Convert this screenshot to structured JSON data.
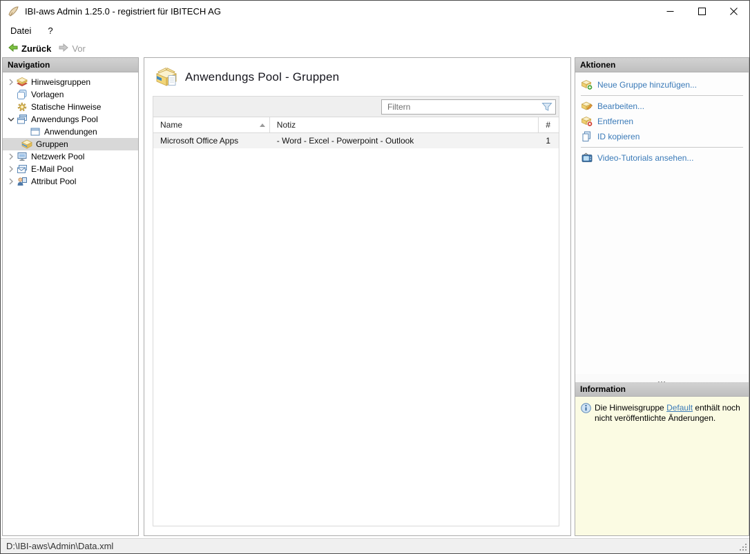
{
  "window": {
    "title": "IBI-aws Admin 1.25.0 - registriert für IBITECH AG",
    "controls": {
      "minimize": "minimize",
      "maximize": "maximize",
      "close": "close"
    }
  },
  "menu": {
    "items": [
      {
        "label": "Datei"
      },
      {
        "label": "?"
      }
    ]
  },
  "toolbar": {
    "back_label": "Zurück",
    "forward_label": "Vor"
  },
  "navigation": {
    "header": "Navigation",
    "items": [
      {
        "label": "Hinweisgruppen",
        "icon": "notice-groups-icon",
        "state": "collapsed",
        "level": 0,
        "selected": false
      },
      {
        "label": "Vorlagen",
        "icon": "templates-icon",
        "state": "leaf",
        "level": 0,
        "selected": false
      },
      {
        "label": "Statische Hinweise",
        "icon": "static-notices-icon",
        "state": "leaf",
        "level": 0,
        "selected": false
      },
      {
        "label": "Anwendungs Pool",
        "icon": "application-pool-icon",
        "state": "expanded",
        "level": 0,
        "selected": false
      },
      {
        "label": "Anwendungen",
        "icon": "applications-icon",
        "state": "leaf",
        "level": 1,
        "selected": false
      },
      {
        "label": "Gruppen",
        "icon": "groups-icon",
        "state": "leaf",
        "level": 1,
        "selected": true
      },
      {
        "label": "Netzwerk Pool",
        "icon": "network-pool-icon",
        "state": "collapsed",
        "level": 0,
        "selected": false
      },
      {
        "label": "E-Mail Pool",
        "icon": "email-pool-icon",
        "state": "collapsed",
        "level": 0,
        "selected": false
      },
      {
        "label": "Attribut Pool",
        "icon": "attribute-pool-icon",
        "state": "collapsed",
        "level": 0,
        "selected": false
      }
    ]
  },
  "main": {
    "title": "Anwendungs Pool - Gruppen",
    "title_icon": "open-box-document-icon",
    "filter": {
      "placeholder": "Filtern",
      "icon": "filter-funnel-icon"
    },
    "table": {
      "columns": [
        "Name",
        "Notiz",
        "#"
      ],
      "sort": {
        "column": "Name",
        "direction": "ascending"
      },
      "rows": [
        {
          "name": "Microsoft Office Apps",
          "note": "- Word - Excel - Powerpoint - Outlook",
          "count": "1"
        }
      ]
    }
  },
  "actions": {
    "header": "Aktionen",
    "items": [
      {
        "label": "Neue Gruppe hinzufügen...",
        "icon": "box-add-icon"
      },
      {
        "label": "Bearbeiten...",
        "icon": "box-edit-icon"
      },
      {
        "label": "Entfernen",
        "icon": "box-remove-icon"
      },
      {
        "label": "ID kopieren",
        "icon": "copy-icon"
      },
      {
        "label": "Video-Tutorials ansehen...",
        "icon": "video-tv-icon"
      }
    ]
  },
  "information": {
    "header": "Information",
    "icon": "info-circle-icon",
    "text_before": "Die Hinweisgruppe ",
    "link": "Default",
    "text_after": " enthält noch nicht veröffentlichte Änderungen."
  },
  "statusbar": {
    "path": "D:\\IBI-aws\\Admin\\Data.xml"
  },
  "colors": {
    "link_blue": "#3a7ab8",
    "info_background": "#fbfbe3",
    "selection_gray": "#d8d8d8",
    "panel_header_gray": "#c6c6c6",
    "back_arrow_green": "#7dc243",
    "forward_arrow_gray": "#b9b9b9"
  }
}
